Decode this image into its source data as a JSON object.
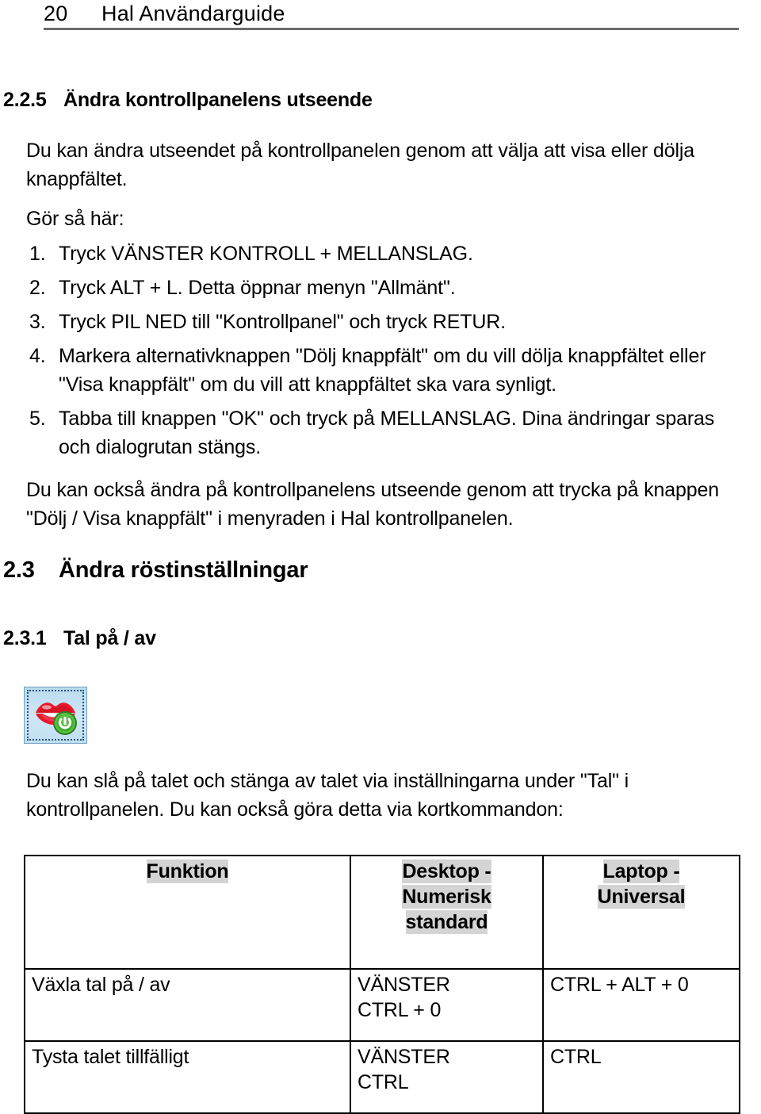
{
  "header": {
    "page_number": "20",
    "document_title": "Hal Användarguide"
  },
  "section_225": {
    "number": "2.2.5",
    "title": "Ändra kontrollpanelens utseende",
    "intro": "Du kan ändra utseendet på kontrollpanelen genom att välja att visa eller dölja knappfältet.",
    "steps_lead": "Gör så här:",
    "steps": [
      {
        "marker": "1.",
        "text": "Tryck VÄNSTER KONTROLL + MELLANSLAG."
      },
      {
        "marker": "2.",
        "text": "Tryck ALT + L. Detta öppnar menyn \"Allmänt\"."
      },
      {
        "marker": "3.",
        "text": "Tryck PIL NED till \"Kontrollpanel\" och tryck RETUR."
      },
      {
        "marker": "4.",
        "text": "Markera alternativknappen \"Dölj knappfält\" om du vill dölja knappfältet eller \"Visa knappfält\" om du vill att knappfältet ska vara synligt."
      },
      {
        "marker": "5.",
        "text": "Tabba till knappen \"OK\" och tryck på MELLANSLAG. Dina ändringar sparas och dialogrutan stängs."
      }
    ],
    "outro": "Du kan också ändra på kontrollpanelens utseende genom att trycka på knappen \"Dölj / Visa knappfält\" i menyraden i Hal kontrollpanelen."
  },
  "section_23": {
    "number": "2.3",
    "title": "Ändra röstinställningar"
  },
  "section_231": {
    "number": "2.3.1",
    "title": "Tal på / av",
    "icon_name": "speech-toggle-icon",
    "body": "Du kan slå på talet och stänga av talet via inställningarna under \"Tal\" i kontrollpanelen. Du kan också göra detta via kortkommandon:"
  },
  "shortcut_table": {
    "headers": {
      "function": "Funktion",
      "desktop": [
        "Desktop -",
        "Numerisk",
        "standard"
      ],
      "laptop": [
        "Laptop -",
        "Universal"
      ]
    },
    "rows": [
      {
        "function": "Växla tal på / av",
        "desktop": [
          "VÄNSTER",
          "CTRL + 0"
        ],
        "laptop": [
          "CTRL + ALT + 0"
        ]
      },
      {
        "function": "Tysta talet tillfälligt",
        "desktop": [
          "VÄNSTER",
          "CTRL"
        ],
        "laptop": [
          "CTRL"
        ]
      }
    ]
  },
  "colors": {
    "rule": "#6b6b6b",
    "header_shade": "#d4d4d4",
    "icon_background": "#c3e1f3",
    "icon_lips": "#e01b24",
    "icon_power_badge": "#3faa2f",
    "text": "#000000"
  }
}
